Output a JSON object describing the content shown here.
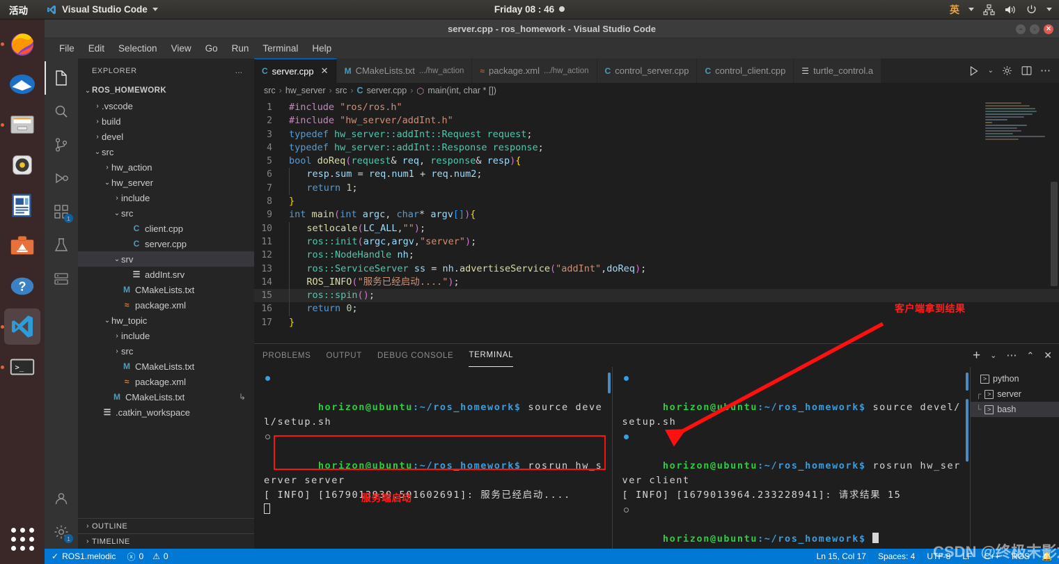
{
  "desktop": {
    "activities_label": "活动",
    "app_name": "Visual Studio Code",
    "clock": "Friday 08 : 46",
    "ime_label": "英",
    "dock_items": [
      {
        "name": "firefox",
        "running": true
      },
      {
        "name": "thunderbird",
        "running": false
      },
      {
        "name": "files",
        "running": true
      },
      {
        "name": "rhythmbox",
        "running": false
      },
      {
        "name": "libreoffice-writer",
        "running": false
      },
      {
        "name": "ubuntu-software",
        "running": false
      },
      {
        "name": "help",
        "running": false
      },
      {
        "name": "visual-studio-code",
        "running": true,
        "active": true
      },
      {
        "name": "terminal",
        "running": true
      }
    ]
  },
  "window": {
    "title": "server.cpp - ros_homework - Visual Studio Code"
  },
  "menu": {
    "items": [
      "File",
      "Edit",
      "Selection",
      "View",
      "Go",
      "Run",
      "Terminal",
      "Help"
    ]
  },
  "activity_bar": {
    "items": [
      {
        "name": "explorer",
        "icon": "files-icon",
        "selected": true,
        "badge": null
      },
      {
        "name": "search",
        "icon": "search-icon",
        "selected": false,
        "badge": null
      },
      {
        "name": "source-control",
        "icon": "source-control-icon",
        "selected": false,
        "badge": null
      },
      {
        "name": "run-and-debug",
        "icon": "debug-icon",
        "selected": false,
        "badge": null
      },
      {
        "name": "extensions",
        "icon": "extensions-icon",
        "selected": false,
        "badge": "1"
      },
      {
        "name": "testing",
        "icon": "beaker-icon",
        "selected": false,
        "badge": null
      },
      {
        "name": "remote-explorer",
        "icon": "remote-icon",
        "selected": false,
        "badge": null
      },
      {
        "name": "accounts",
        "icon": "account-icon",
        "selected": false,
        "badge": null
      },
      {
        "name": "manage",
        "icon": "gear-icon",
        "selected": false,
        "badge": "1"
      }
    ]
  },
  "sidebar": {
    "header_title": "EXPLORER",
    "header_more": "…",
    "root": "ROS_HOMEWORK",
    "tree": [
      {
        "label": ".vscode",
        "depth": 1,
        "twisty": "collapsed",
        "icon": "folder",
        "selected": false
      },
      {
        "label": "build",
        "depth": 1,
        "twisty": "collapsed",
        "icon": "folder",
        "selected": false
      },
      {
        "label": "devel",
        "depth": 1,
        "twisty": "collapsed",
        "icon": "folder",
        "selected": false
      },
      {
        "label": "src",
        "depth": 1,
        "twisty": "expanded",
        "icon": "folder",
        "selected": false
      },
      {
        "label": "hw_action",
        "depth": 2,
        "twisty": "collapsed",
        "icon": "folder",
        "selected": false
      },
      {
        "label": "hw_server",
        "depth": 2,
        "twisty": "expanded",
        "icon": "folder",
        "selected": false
      },
      {
        "label": "include",
        "depth": 3,
        "twisty": "collapsed",
        "icon": "folder",
        "selected": false
      },
      {
        "label": "src",
        "depth": 3,
        "twisty": "expanded",
        "icon": "folder",
        "selected": false
      },
      {
        "label": "client.cpp",
        "depth": 4,
        "twisty": "none",
        "icon": "cpp",
        "selected": false
      },
      {
        "label": "server.cpp",
        "depth": 4,
        "twisty": "none",
        "icon": "cpp",
        "selected": false
      },
      {
        "label": "srv",
        "depth": 3,
        "twisty": "expanded",
        "icon": "folder",
        "selected": true
      },
      {
        "label": "addInt.srv",
        "depth": 4,
        "twisty": "none",
        "icon": "txt",
        "selected": false
      },
      {
        "label": "CMakeLists.txt",
        "depth": 3,
        "twisty": "none",
        "icon": "m",
        "selected": false
      },
      {
        "label": "package.xml",
        "depth": 3,
        "twisty": "none",
        "icon": "xml",
        "selected": false
      },
      {
        "label": "hw_topic",
        "depth": 2,
        "twisty": "expanded",
        "icon": "folder",
        "selected": false
      },
      {
        "label": "include",
        "depth": 3,
        "twisty": "collapsed",
        "icon": "folder",
        "selected": false
      },
      {
        "label": "src",
        "depth": 3,
        "twisty": "collapsed",
        "icon": "folder",
        "selected": false
      },
      {
        "label": "CMakeLists.txt",
        "depth": 3,
        "twisty": "none",
        "icon": "m",
        "selected": false
      },
      {
        "label": "package.xml",
        "depth": 3,
        "twisty": "none",
        "icon": "xml",
        "selected": false
      },
      {
        "label": "CMakeLists.txt",
        "depth": 2,
        "twisty": "none",
        "icon": "m",
        "selected": false,
        "trailing": "↳"
      },
      {
        "label": ".catkin_workspace",
        "depth": 1,
        "twisty": "none",
        "icon": "txt",
        "selected": false
      }
    ],
    "sections": [
      {
        "label": "OUTLINE",
        "twisty": "collapsed"
      },
      {
        "label": "TIMELINE",
        "twisty": "collapsed"
      }
    ]
  },
  "editor": {
    "tabs": [
      {
        "label": "server.cpp",
        "sub": "",
        "icon": "cpp",
        "active": true,
        "closable": true
      },
      {
        "label": "CMakeLists.txt",
        "sub": ".../hw_action",
        "icon": "m",
        "active": false,
        "closable": false
      },
      {
        "label": "package.xml",
        "sub": ".../hw_action",
        "icon": "xml",
        "active": false,
        "closable": false
      },
      {
        "label": "control_server.cpp",
        "sub": "",
        "icon": "cpp",
        "active": false,
        "closable": false
      },
      {
        "label": "control_client.cpp",
        "sub": "",
        "icon": "cpp",
        "active": false,
        "closable": false
      },
      {
        "label": "turtle_control.a",
        "sub": "",
        "icon": "txt",
        "active": false,
        "closable": false
      }
    ],
    "breadcrumb": [
      "src",
      "hw_server",
      "src",
      "server.cpp",
      "main(int, char * [])"
    ],
    "current_line": 15,
    "lines": [
      {
        "n": 1,
        "text": "#include \"ros/ros.h\""
      },
      {
        "n": 2,
        "text": "#include \"hw_server/addInt.h\""
      },
      {
        "n": 3,
        "text": "typedef hw_server::addInt::Request request;"
      },
      {
        "n": 4,
        "text": "typedef hw_server::addInt::Response response;"
      },
      {
        "n": 5,
        "text": "bool doReq(request& req, response& resp){"
      },
      {
        "n": 6,
        "text": "    resp.sum = req.num1 + req.num2;"
      },
      {
        "n": 7,
        "text": "    return 1;"
      },
      {
        "n": 8,
        "text": "}"
      },
      {
        "n": 9,
        "text": "int main(int argc, char* argv[]){"
      },
      {
        "n": 10,
        "text": "    setlocale(LC_ALL,\"\");"
      },
      {
        "n": 11,
        "text": "    ros::init(argc,argv,\"server\");"
      },
      {
        "n": 12,
        "text": "    ros::NodeHandle nh;"
      },
      {
        "n": 13,
        "text": "    ros::ServiceServer ss = nh.advertiseService(\"addInt\",doReq);"
      },
      {
        "n": 14,
        "text": "    ROS_INFO(\"服务已经启动....\");"
      },
      {
        "n": 15,
        "text": "    ros::spin();"
      },
      {
        "n": 16,
        "text": "    return 0;"
      },
      {
        "n": 17,
        "text": "}"
      }
    ]
  },
  "panel": {
    "tabs": [
      "PROBLEMS",
      "OUTPUT",
      "DEBUG CONSOLE",
      "TERMINAL"
    ],
    "active_tab": "TERMINAL",
    "actions": [
      "add-terminal",
      "split-dropdown",
      "more",
      "maximize",
      "close"
    ],
    "terminals": {
      "left": {
        "lines": [
          {
            "type": "prompt",
            "bullet": "filled",
            "user": "horizon@ubuntu",
            "path": ":~/ros_homework$",
            "cmd": " source devel/setup.sh"
          },
          {
            "type": "prompt",
            "bullet": "hollow",
            "user": "horizon@ubuntu",
            "path": ":~/ros_homework$",
            "cmd": " rosrun hw_server server"
          },
          {
            "type": "output",
            "text": "[ INFO] [1679013939.501602691]: 服务已经启动...."
          }
        ],
        "cursor": "outline"
      },
      "right": {
        "lines": [
          {
            "type": "prompt",
            "bullet": "filled",
            "user": "horizon@ubuntu",
            "path": ":~/ros_homework$",
            "cmd": " source devel/setup.sh"
          },
          {
            "type": "prompt",
            "bullet": "filled",
            "user": "horizon@ubuntu",
            "path": ":~/ros_homework$",
            "cmd": " rosrun hw_server client"
          },
          {
            "type": "output",
            "text": "[ INFO] [1679013964.233228941]: 请求结果 15"
          },
          {
            "type": "prompt",
            "bullet": "hollow",
            "user": "horizon@ubuntu",
            "path": ":~/ros_homework$",
            "cmd": " "
          }
        ],
        "cursor": "block"
      }
    },
    "terminal_list": [
      {
        "label": "python",
        "depth": 0,
        "selected": false,
        "branch": ""
      },
      {
        "label": "server",
        "depth": 1,
        "selected": false,
        "branch": "┌"
      },
      {
        "label": "bash",
        "depth": 1,
        "selected": true,
        "branch": "└"
      }
    ]
  },
  "status_bar": {
    "left": [
      {
        "name": "ros-status",
        "icon": "check-icon",
        "label": "ROS1.melodic"
      },
      {
        "name": "errors",
        "icon": "error-icon",
        "label": "0"
      },
      {
        "name": "warnings",
        "icon": "warning-icon",
        "label": "0"
      }
    ],
    "right": [
      {
        "name": "cursor-position",
        "label": "Ln 15, Col 17"
      },
      {
        "name": "indentation",
        "label": "Spaces: 4"
      },
      {
        "name": "encoding",
        "label": "UTF-8"
      },
      {
        "name": "eol",
        "label": "LF"
      },
      {
        "name": "language-mode",
        "label": "C++"
      },
      {
        "name": "ros-distro",
        "label": "ROS"
      },
      {
        "name": "notifications",
        "label": ""
      }
    ]
  },
  "annotations": {
    "client_result": "客户端拿到结果",
    "server_start": "服务端启动",
    "watermark": "CSDN @终极末影龙"
  },
  "colors": {
    "accent": "#0078d4",
    "annotation_red": "#ff1e1e",
    "terminal_green": "#2ecc40",
    "terminal_blue": "#3b9ddd"
  }
}
